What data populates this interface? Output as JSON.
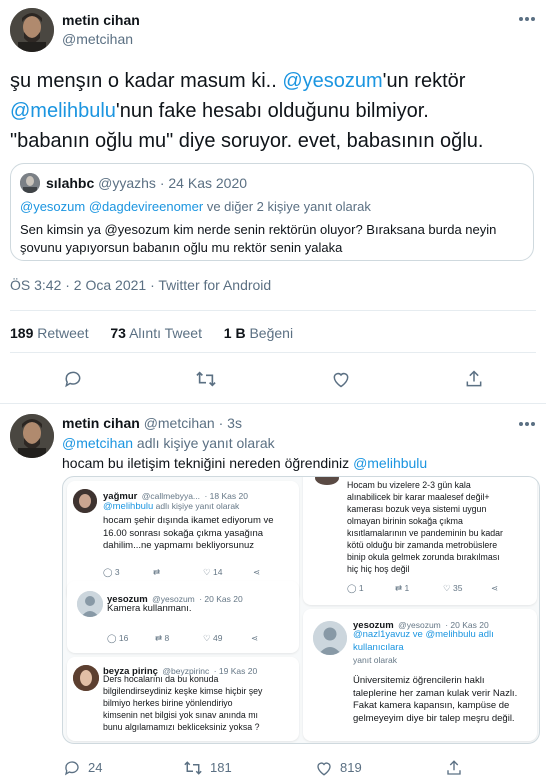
{
  "main_tweet": {
    "author_name": "metin cihan",
    "handle": "@metcihan",
    "text": {
      "part1": "şu menşın o kadar masum ki.. ",
      "mention1": "@yesozum",
      "part2": "'un rektör ",
      "mention2": "@melihbulu",
      "part3": "'nun fake hesabı olduğunu bilmiyor.",
      "line3": "\"babanın oğlu mu\" diye soruyor. evet, babasının oğlu."
    },
    "quote": {
      "author_name": "sılahbc",
      "handle": "@yyazhs",
      "separator": "·",
      "date": "24 Kas 2020",
      "reply_to_mentions": "@yesozum @dagdevireenomer",
      "reply_to_suffix": " ve diğer 2 kişiye yanıt olarak",
      "line1": "Sen kimsin ya @yesozum kim nerde senin rektörün oluyor? Bıraksana burda neyin",
      "line2": "şovunu yapıyorsun babanın oğlu mu rektör senin yalaka"
    },
    "timestamp": "ÖS 3:42 · 2 Oca 2021 · Twitter for Android",
    "stats": {
      "retweets": "189",
      "retweets_label": "Retweet",
      "quotes": "73",
      "quotes_label": "Alıntı Tweet",
      "likes": "1 B",
      "likes_label": "Beğeni"
    }
  },
  "reply_tweet": {
    "author_name": "metin cihan",
    "handle": "@metcihan",
    "time": "· 3s",
    "replying_mention": "@metcihan",
    "replying_suffix": " adlı kişiye yanıt olarak",
    "text": "hocam bu iletişim tekniğini nereden öğrendiniz ",
    "text_mention": "@melihbulu",
    "actions": {
      "replies": "24",
      "retweets": "181",
      "likes": "819"
    },
    "screenshot": {
      "c1": {
        "name": "yağmur",
        "handle": "@callmebyya...",
        "date": "· 18 Kas 20",
        "reply_mention": "@melihbulu",
        "reply_suffix": " adlı kişiye yanıt olarak",
        "lines": [
          "hocam şehir dışında ikamet ediyorum ve",
          "16.00 sonrası sokağa çıkma yasağına",
          "dahilim...ne yapmamı bekliyorsunuz"
        ],
        "a1": "3",
        "a2": "",
        "a3": "14"
      },
      "c2": {
        "name": "yesozum",
        "handle": "@yesozum",
        "date": "· 20 Kas 20",
        "text": "Kamera kullanmanı.",
        "a1": "16",
        "a2": "8",
        "a3": "49"
      },
      "c3": {
        "name": "beyza pirinç",
        "handle": "@beyzpirinc",
        "date": "· 19 Kas 20",
        "lines": [
          "Ders hocalarını da bu konuda",
          "bilgilendirseydiniz keşke kimse hiçbir şey",
          "bilmiyo herkes birine yönlendiriyo",
          "kimsenin net bilgisi yok sınav anında mı",
          "bunu algılamamızı bekliceksiniz yoksa ?"
        ]
      },
      "c4": {
        "lines": [
          "Hocam bu vizelere 2-3 gün kala",
          "alınabilicek bir karar maalesef değil+",
          "kamerası bozuk veya sistemi uygun",
          "olmayan birinin sokağa çıkma",
          "kısıtlamalarının ve pandeminin bu kadar",
          "kötü olduğu bir zamanda metrobüslere",
          "binip okula gelmek zorunda bırakılması",
          "hiç hiç hoş değil"
        ],
        "a1": "1",
        "a2": "1",
        "a3": "35"
      },
      "c5": {
        "name": "yesozum",
        "handle": "@yesozum",
        "date": "· 20 Kas 20",
        "reply_mentions": "@nazl1yavuz ve @melihbulu adlı kullanıcılara",
        "reply_suffix": " yanıt olarak",
        "lines": [
          "Üniversitemiz öğrencilerin haklı",
          "taleplerine her zaman kulak verir Nazlı.",
          "Fakat kamera kapansın, kampüse de",
          "gelmeyeyim diye bir talep meşru değil."
        ]
      }
    }
  },
  "colors": {
    "link": "#1b95e0",
    "muted": "#5b7083",
    "border": "#e6ecf0"
  }
}
